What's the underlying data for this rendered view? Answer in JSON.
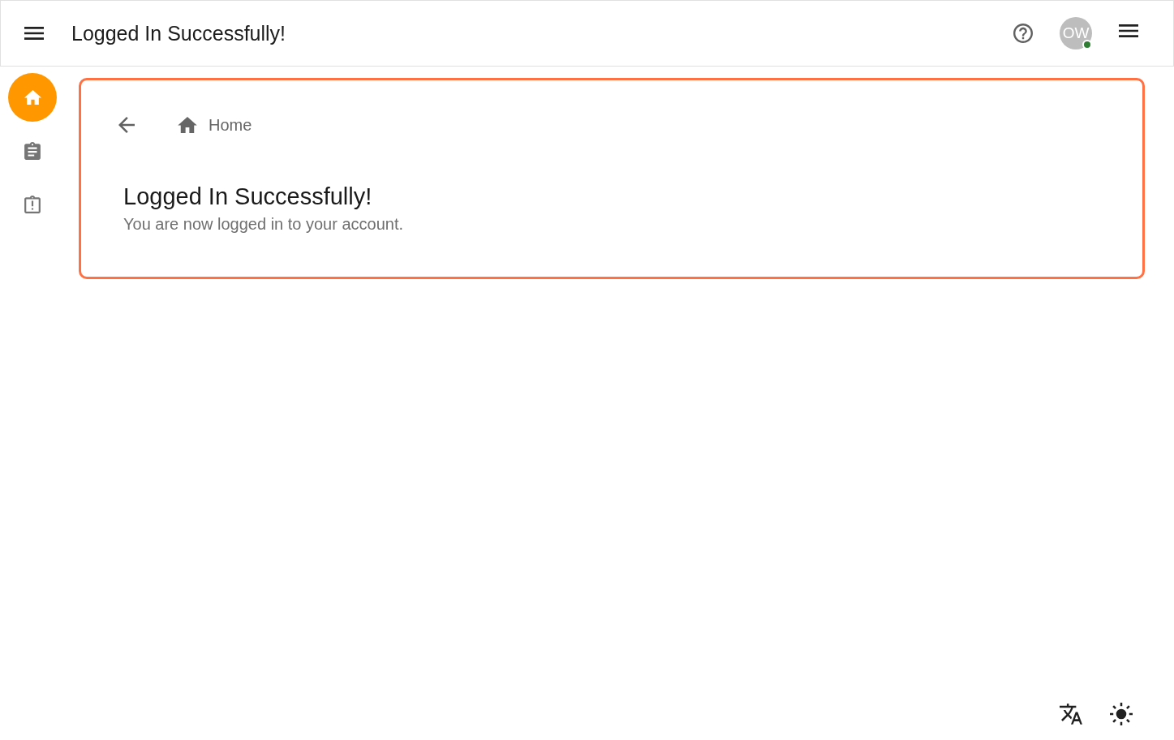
{
  "header": {
    "title": "Logged In Successfully!",
    "avatar": {
      "initials": "OW",
      "online": true
    }
  },
  "nav_rail": {
    "items": [
      {
        "kind": "home",
        "selected": true
      },
      {
        "kind": "clipboard",
        "selected": false
      },
      {
        "kind": "clipboard-alert",
        "selected": false
      }
    ]
  },
  "card": {
    "breadcrumb": [
      {
        "label": "Home"
      }
    ],
    "title": "Logged In Successfully!",
    "subtitle": "You are now logged in to your account."
  }
}
